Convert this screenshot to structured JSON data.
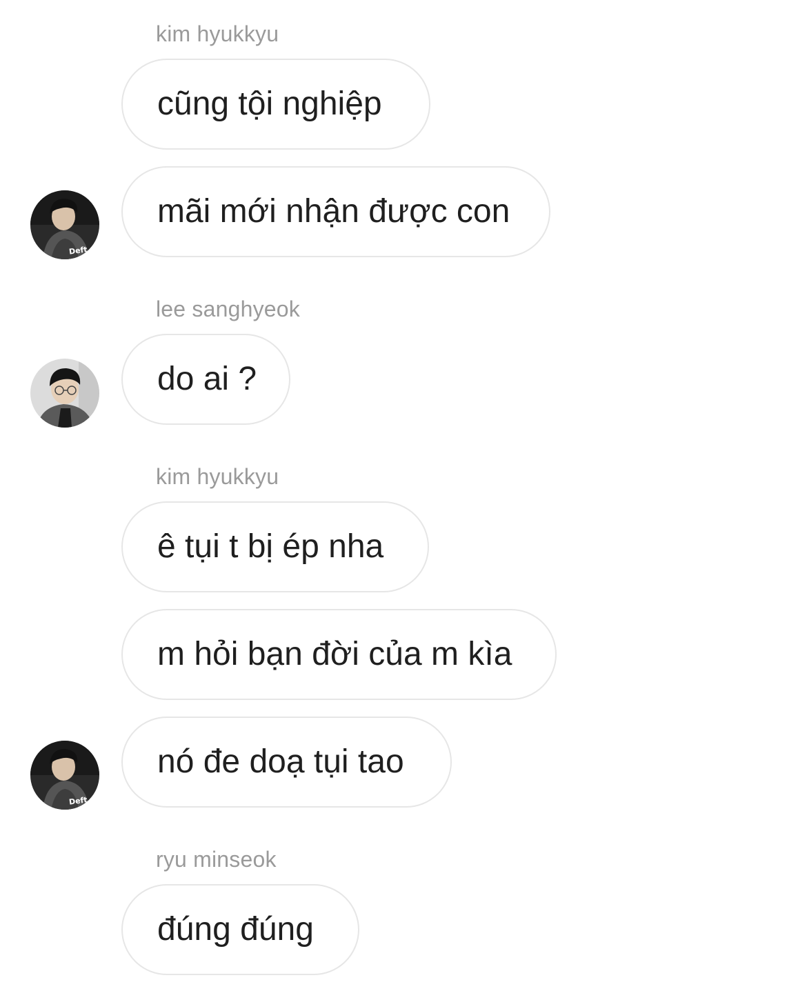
{
  "messages": [
    {
      "sender": "kim hyukkyu",
      "text": "cũng tội nghiệp"
    },
    {
      "text": "mãi mới nhận được con",
      "avatar_caption": "Deft"
    },
    {
      "sender": "lee sanghyeok",
      "text": "do ai ?"
    },
    {
      "sender": "kim hyukkyu",
      "text": "ê tụi t bị ép nha"
    },
    {
      "text": "m hỏi bạn đời của m kìa"
    },
    {
      "text": "nó đe doạ tụi tao",
      "avatar_caption": "Deft"
    },
    {
      "sender": "ryu minseok",
      "text": "đúng đúng"
    }
  ]
}
